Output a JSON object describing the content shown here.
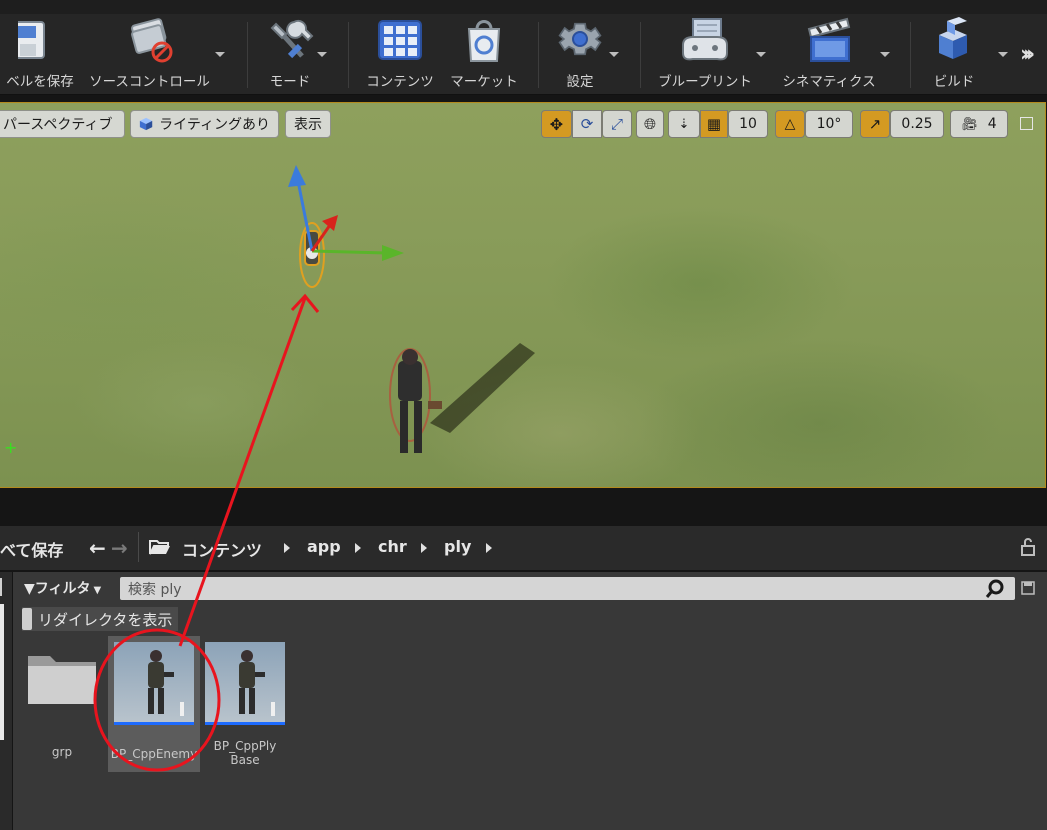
{
  "toolbar": {
    "items": [
      {
        "label": "ベルを保存",
        "icon": "save-icon"
      },
      {
        "label": "ソースコントロール",
        "icon": "source-control-icon"
      },
      {
        "label": "モード",
        "icon": "modes-icon"
      },
      {
        "label": "コンテンツ",
        "icon": "content-icon"
      },
      {
        "label": "マーケット",
        "icon": "marketplace-icon"
      },
      {
        "label": "設定",
        "icon": "settings-icon"
      },
      {
        "label": "ブループリント",
        "icon": "blueprint-icon"
      },
      {
        "label": "シネマティクス",
        "icon": "cinematics-icon"
      },
      {
        "label": "ビルド",
        "icon": "build-icon"
      }
    ],
    "more_icon": "chevron-double-right-icon"
  },
  "viewport": {
    "perspective_label": "パースペクティブ",
    "lighting_label": "ライティングあり",
    "show_label": "表示",
    "grid_snap_value": "10",
    "rotation_snap_value": "10°",
    "scale_snap_value": "0.25",
    "camera_speed_value": "4",
    "colors": {
      "border": "#b48a1e",
      "active_tool": "#d49a22"
    }
  },
  "content_browser": {
    "save_all_label": "べて保存",
    "breadcrumbs": [
      "コンテンツ",
      "app",
      "chr",
      "ply"
    ],
    "filter_label": "フィルタ",
    "search_value": "検索 ply",
    "show_redirectors_label": "リダイレクタを表示",
    "assets": [
      {
        "name": "grp",
        "type": "folder"
      },
      {
        "name": "BP_CppEnemy",
        "type": "blueprint",
        "selected": true
      },
      {
        "name": "BP_CppPly Base",
        "type": "blueprint",
        "selected": false
      }
    ]
  },
  "annotation": {
    "color": "#e8141e"
  }
}
